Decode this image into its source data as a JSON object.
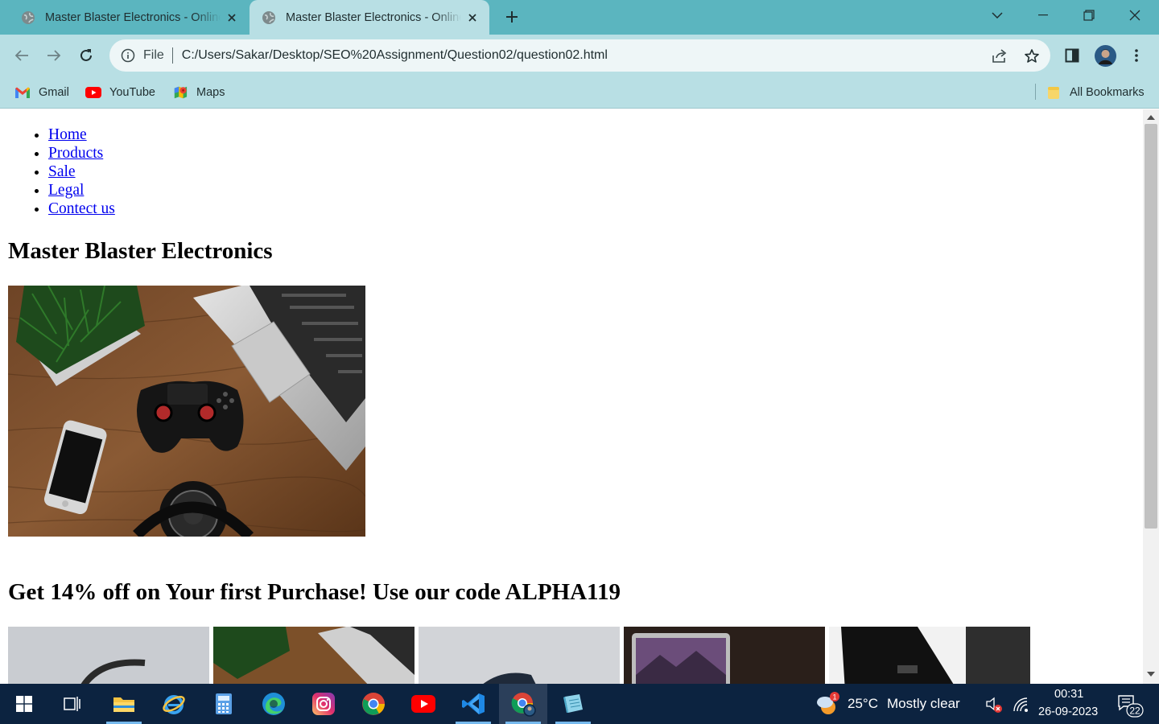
{
  "browser": {
    "tabs": [
      {
        "title": "Master Blaster Electronics - Online"
      },
      {
        "title": "Master Blaster Electronics - Online"
      }
    ],
    "omnibox": {
      "scheme_label": "File",
      "url": "C:/Users/Sakar/Desktop/SEO%20Assignment/Question02/question02.html"
    },
    "bookmarks": [
      {
        "label": "Gmail",
        "icon": "gmail-icon"
      },
      {
        "label": "YouTube",
        "icon": "youtube-icon"
      },
      {
        "label": "Maps",
        "icon": "maps-icon"
      }
    ],
    "all_bookmarks_label": "All Bookmarks"
  },
  "page": {
    "nav": [
      "Home",
      "Products",
      "Sale",
      "Legal",
      "Contect us"
    ],
    "title": "Master Blaster Electronics",
    "hero_image": "desk-electronics-image",
    "promo": "Get 14% off on Your first Purchase! Use our code ALPHA119",
    "thumbnails": [
      "headphones-image",
      "desk-electronics-image",
      "cap-image",
      "laptop-image",
      "monitor-image"
    ]
  },
  "taskbar": {
    "apps": [
      "start-icon",
      "task-view-icon",
      "file-explorer-icon",
      "internet-explorer-icon",
      "edge-icon",
      "instagram-icon",
      "chrome-icon",
      "youtube-icon",
      "vscode-icon",
      "chrome-profile-icon",
      "notepad-icon"
    ],
    "weather": {
      "temp": "25°C",
      "desc": "Mostly clear",
      "badge": "1"
    },
    "time": "00:31",
    "date": "26-09-2023",
    "notifications": "22"
  },
  "colors": {
    "tabbar": "#5bb5bf",
    "toolbar": "#b8dfe4",
    "link": "#0000ee",
    "taskbar": "#0c2340"
  }
}
